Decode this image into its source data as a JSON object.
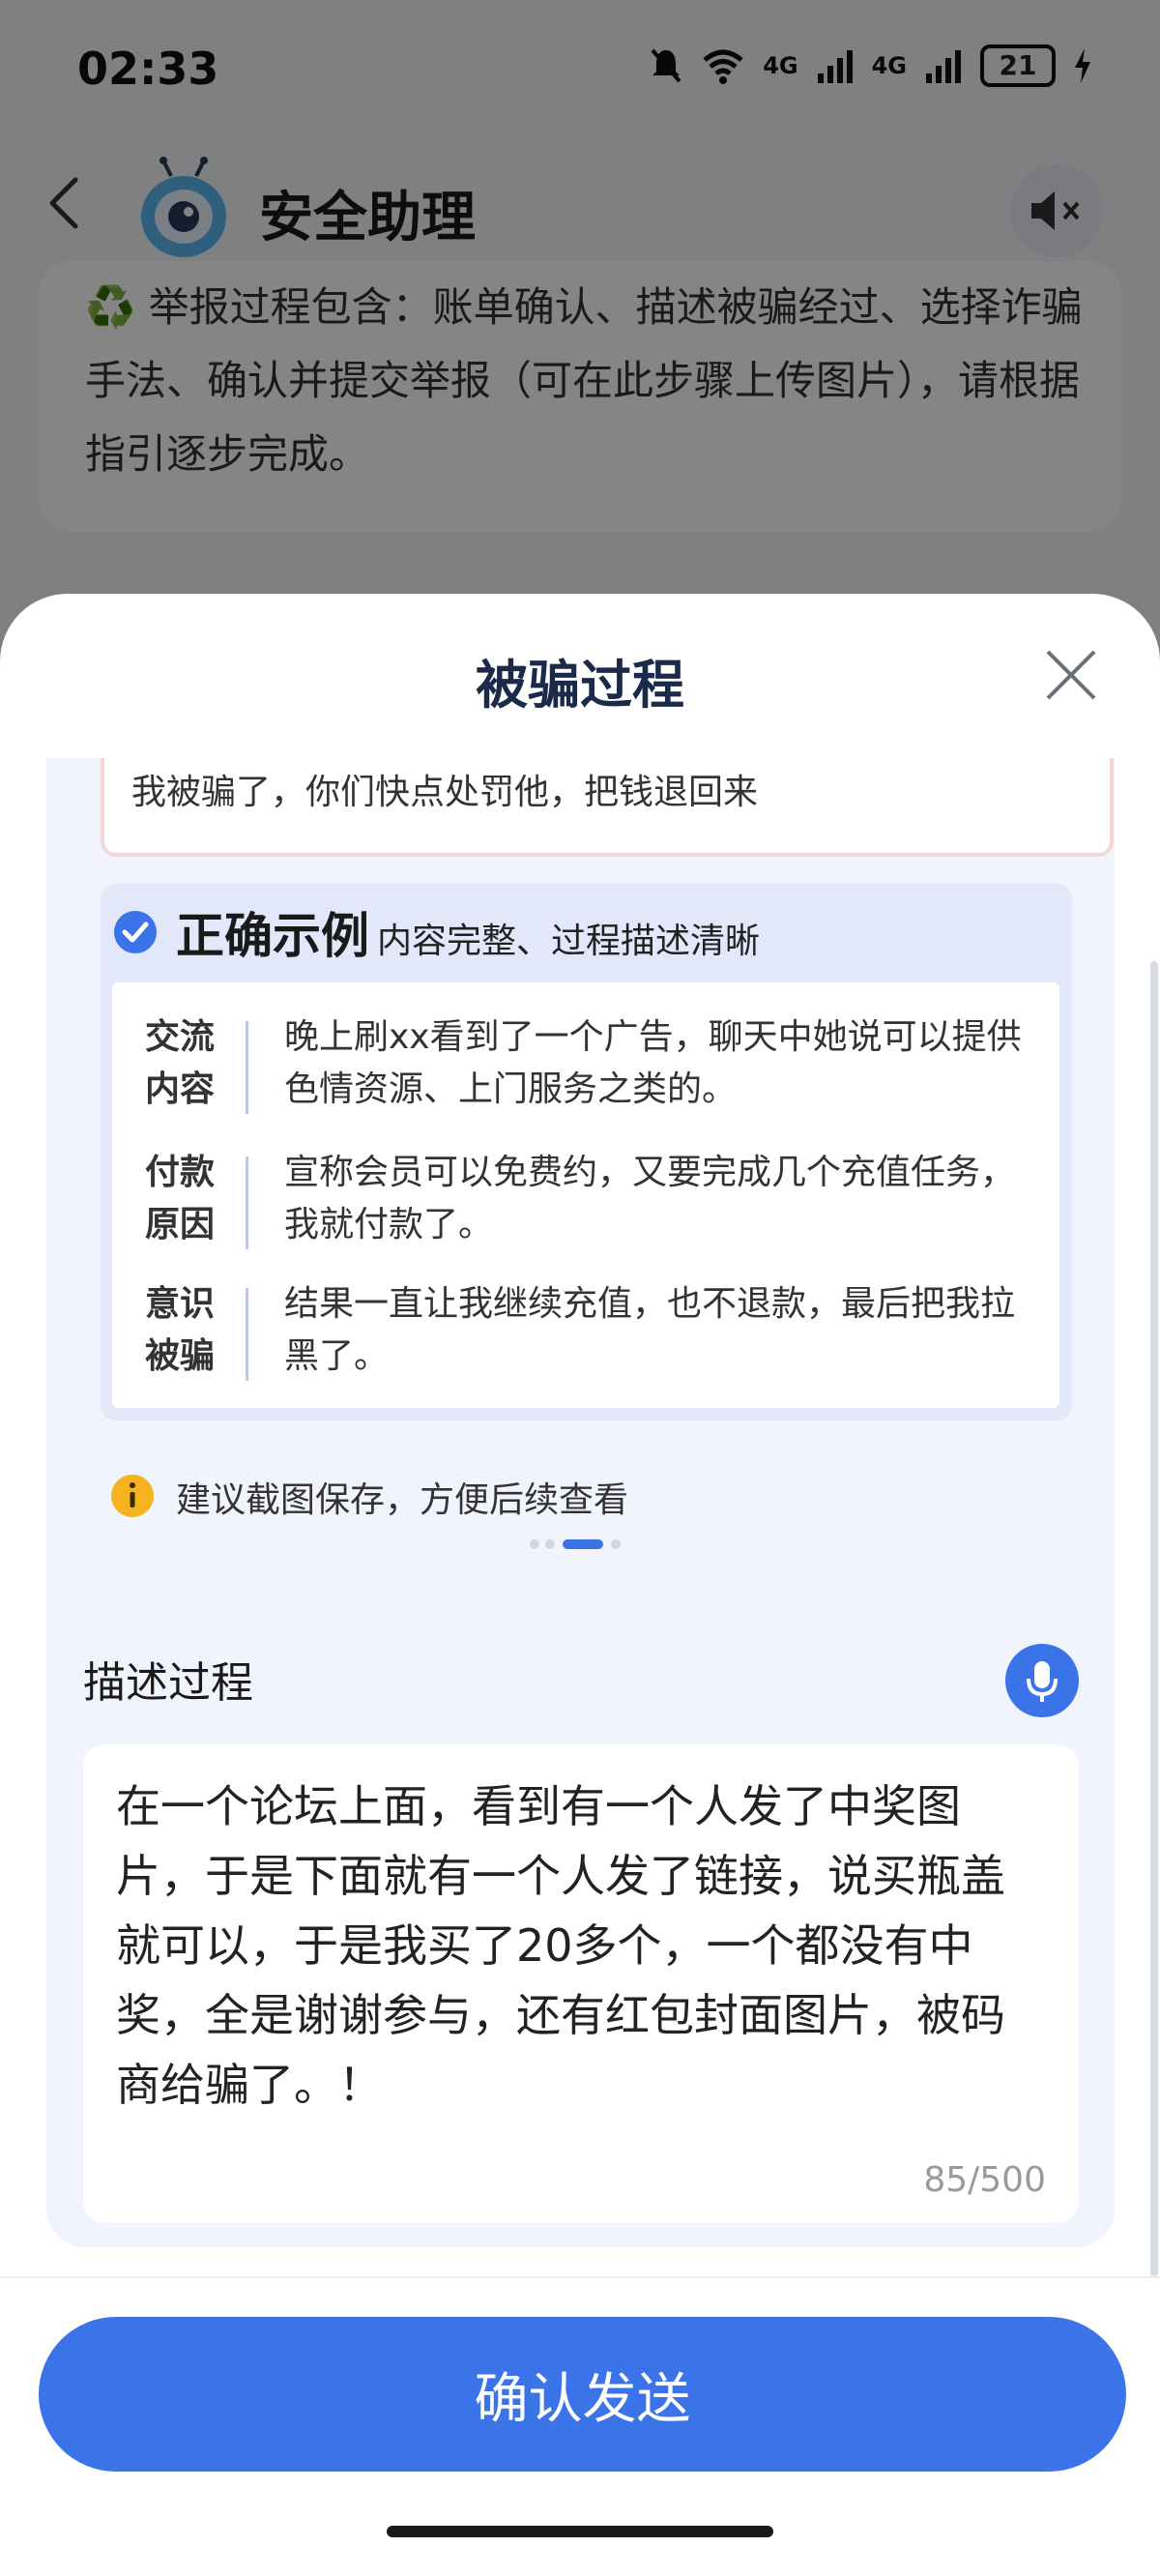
{
  "status_bar": {
    "time": "02:33",
    "network_1": "4G",
    "network_2": "4G",
    "battery": "21"
  },
  "header": {
    "title": "安全助理"
  },
  "background_card": {
    "text": "♻️ 举报过程包含：账单确认、描述被骗经过、选择诈骗手法、确认并提交举报（可在此步骤上传图片），请根据指引逐步完成。"
  },
  "sheet": {
    "title": "被骗过程",
    "wrong_example_text": "我被骗了，你们快点处罚他，把钱退回来",
    "correct_example": {
      "title": "正确示例",
      "subtitle": "内容完整、过程描述清晰",
      "rows": [
        {
          "label": "交流内容",
          "content": "晚上刷xx看到了一个广告，聊天中她说可以提供色情资源、上门服务之类的。"
        },
        {
          "label": "付款原因",
          "content": "宣称会员可以免费约，又要完成几个充值任务，我就付款了。"
        },
        {
          "label": "意识被骗",
          "content": "结果一直让我继续充值，也不退款，最后把我拉黑了。"
        }
      ]
    },
    "tip": "建议截图保存，方便后续查看",
    "carousel": {
      "count": 4,
      "active_index": 2
    },
    "describe": {
      "title": "描述过程",
      "text": "在一个论坛上面，看到有一个人发了中奖图片，于是下面就有一个人发了链接，说买瓶盖就可以，于是我买了20多个，一个都没有中奖，全是谢谢参与，还有红包封面图片，被码商给骗了。！",
      "count": "85/500"
    },
    "confirm_label": "确认发送"
  },
  "colors": {
    "accent": "#3b73e8",
    "tip_icon": "#f5b41d",
    "overlay": "rgba(0,0,0,0.48)"
  }
}
